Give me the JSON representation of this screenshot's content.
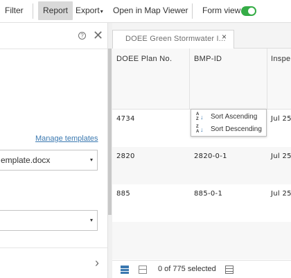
{
  "toolbar": {
    "filter": "Filter",
    "report": "Report",
    "export": "Export",
    "export_caret": "▾",
    "open_map_viewer": "Open in Map Viewer",
    "form_view": "Form view",
    "form_view_on": true
  },
  "left_panel": {
    "help_icon": "?",
    "close_icon": "✕",
    "manage_templates": "Manage templates",
    "template_select": "emplate.docx",
    "second_select": "",
    "dropdown_caret": "▾",
    "footer_chevron": "›"
  },
  "tab": {
    "label": "DOEE Green Stormwater I...",
    "close": "×"
  },
  "table": {
    "columns": [
      "DOEE Plan No.",
      "BMP-ID",
      "Inspe"
    ],
    "rows": [
      [
        "4734",
        "",
        "Jul 25"
      ],
      [
        "2820",
        "2820-0-1",
        "Jul 25"
      ],
      [
        "885",
        "885-0-1",
        "Jul 25"
      ]
    ]
  },
  "sort_menu": {
    "ascending": "Sort Ascending",
    "descending": "Sort Descending",
    "asc_icon_top": "A",
    "asc_icon_bottom": "Z",
    "desc_icon_top": "Z",
    "desc_icon_bottom": "A",
    "arrow_down": "↓"
  },
  "status": {
    "selected_text": "0 of 775 selected"
  },
  "colors": {
    "toggle_on": "#35ac46",
    "link": "#3a78b0",
    "report_active_bg": "#d9d9d9"
  }
}
